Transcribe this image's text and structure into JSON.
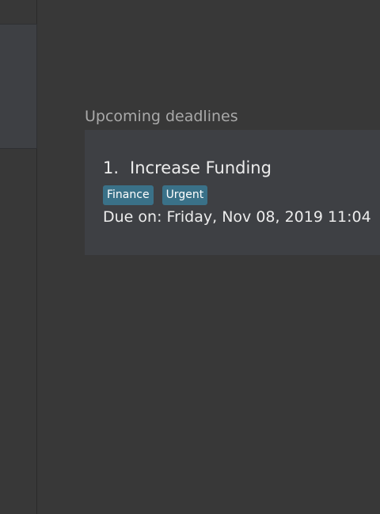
{
  "section": {
    "title": "Upcoming deadlines"
  },
  "deadlines": [
    {
      "index": "1.",
      "title": "Increase Funding",
      "tags": [
        "Finance",
        "Urgent"
      ],
      "due_label": "Due on:",
      "due_date": "Friday, Nov 08, 2019 11:04"
    }
  ],
  "colors": {
    "background": "#383838",
    "card": "#3e4044",
    "tag": "#3a7188"
  }
}
